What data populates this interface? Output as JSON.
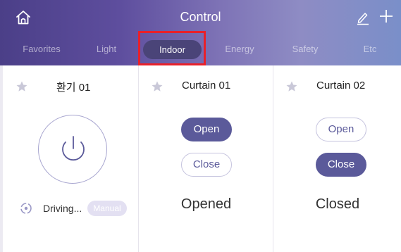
{
  "header": {
    "title": "Control",
    "icons": {
      "home": "home-icon",
      "edit": "pencil-icon",
      "add": "plus-icon"
    }
  },
  "tabs": [
    {
      "label": "Favorites"
    },
    {
      "label": "Light"
    },
    {
      "label": "Indoor"
    },
    {
      "label": "Energy"
    },
    {
      "label": "Safety"
    },
    {
      "label": "Etc"
    }
  ],
  "selected_tab": "Indoor",
  "devices": {
    "ventilation": {
      "name": "환기 01",
      "status": "Driving...",
      "mode": "Manual",
      "icons": {
        "favorite": "star-icon",
        "power": "power-icon",
        "status": "fan-icon"
      }
    },
    "curtain1": {
      "name": "Curtain 01",
      "open_label": "Open",
      "close_label": "Close",
      "state": "Opened",
      "active_button": "Open"
    },
    "curtain2": {
      "name": "Curtain 02",
      "open_label": "Open",
      "close_label": "Close",
      "state": "Closed",
      "active_button": "Close"
    }
  },
  "colors": {
    "accent": "#5b5a9a",
    "highlight": "#e8202a",
    "star": "#c9c8d8"
  }
}
